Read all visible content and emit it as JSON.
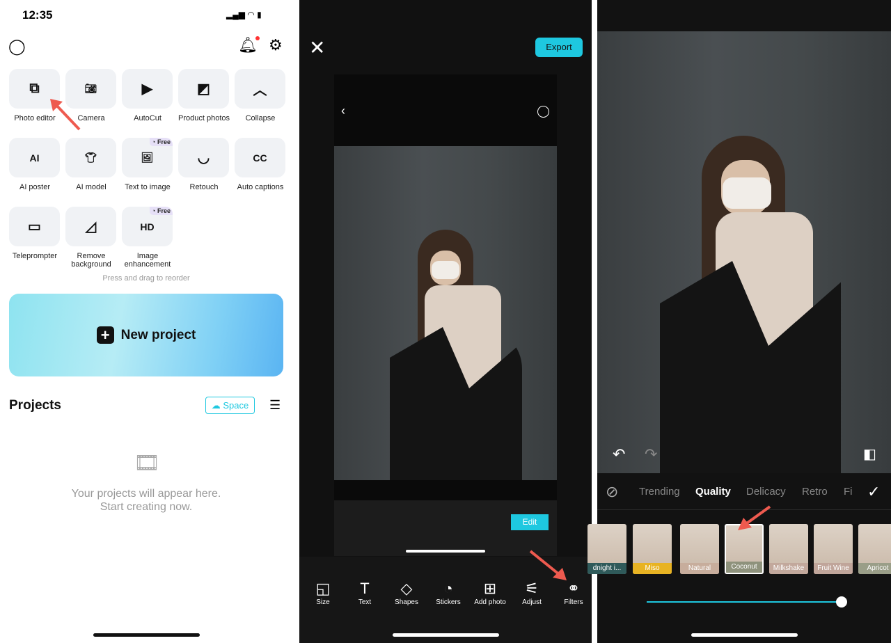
{
  "home": {
    "time": "12:35",
    "tiles": [
      {
        "label": "Photo editor",
        "icon": "photo-editor-icon",
        "glyph": "⧉"
      },
      {
        "label": "Camera",
        "icon": "camera-icon",
        "glyph": "📷︎"
      },
      {
        "label": "AutoCut",
        "icon": "autocut-icon",
        "glyph": "▶"
      },
      {
        "label": "Product photos",
        "icon": "product-photos-icon",
        "glyph": "◩"
      },
      {
        "label": "Collapse",
        "icon": "chevron-up-icon",
        "glyph": "︿"
      },
      {
        "label": "AI poster",
        "icon": "ai-poster-icon",
        "glyph": "AI"
      },
      {
        "label": "AI model",
        "icon": "ai-model-icon",
        "glyph": "👕︎"
      },
      {
        "label": "Text to image",
        "icon": "text-to-image-icon",
        "glyph": "🖼︎",
        "badge": "Free"
      },
      {
        "label": "Retouch",
        "icon": "retouch-icon",
        "glyph": "◡"
      },
      {
        "label": "Auto captions",
        "icon": "captions-icon",
        "glyph": "CC"
      },
      {
        "label": "Teleprompter",
        "icon": "teleprompter-icon",
        "glyph": "▭"
      },
      {
        "label": "Remove background",
        "icon": "remove-bg-icon",
        "glyph": "◿"
      },
      {
        "label": "Image enhancement",
        "icon": "hd-icon",
        "glyph": "HD",
        "badge": "Free"
      }
    ],
    "reorder_hint": "Press and drag to reorder",
    "new_project": "New project",
    "projects_title": "Projects",
    "space_label": "Space",
    "empty_line1": "Your projects will appear here.",
    "empty_line2": "Start creating now."
  },
  "editor": {
    "export": "Export",
    "edit": "Edit",
    "tools": [
      {
        "label": "Size",
        "glyph": "◱"
      },
      {
        "label": "Text",
        "glyph": "T"
      },
      {
        "label": "Shapes",
        "glyph": "◇"
      },
      {
        "label": "Stickers",
        "glyph": "◔"
      },
      {
        "label": "Add photo",
        "glyph": "⊞"
      },
      {
        "label": "Adjust",
        "glyph": "⚟"
      },
      {
        "label": "Filters",
        "glyph": "⚭"
      }
    ]
  },
  "filters": {
    "tabs": [
      "Trending",
      "Quality",
      "Delicacy",
      "Retro",
      "Fi"
    ],
    "active_tab": "Quality",
    "items": [
      {
        "label": "dnight i...",
        "color": "#2f5a5a"
      },
      {
        "label": "Miso",
        "color": "#e8b323"
      },
      {
        "label": "Natural",
        "color": "#c7ad9c"
      },
      {
        "label": "Coconut",
        "color": "#8e927c"
      },
      {
        "label": "Milkshake",
        "color": "#c2a89c"
      },
      {
        "label": "Fruit Wine",
        "color": "#c0a59a"
      },
      {
        "label": "Apricot",
        "color": "#9a9e88"
      }
    ],
    "selected": "Coconut",
    "intensity": 1.0
  },
  "colors": {
    "accent": "#1ec8e0",
    "arrow": "#ee5a4f"
  }
}
